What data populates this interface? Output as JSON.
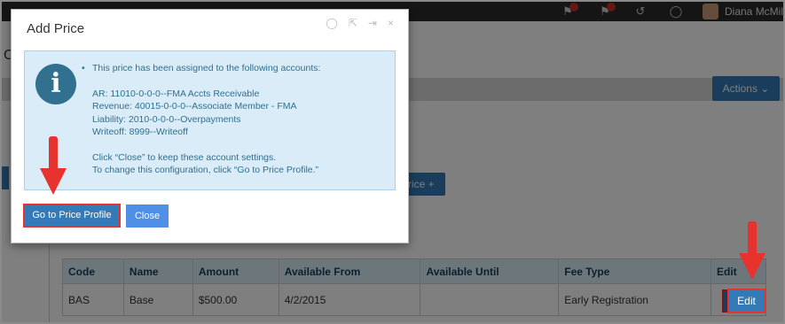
{
  "topbar": {
    "user_name": "Diana McMilli",
    "icons": [
      "flag-icon",
      "alert-icon",
      "history-icon",
      "chat-icon"
    ]
  },
  "background": {
    "actions_label": "Actions ⌄",
    "price_button_label": "rice +",
    "c_letter": "C"
  },
  "table": {
    "headers": [
      "Code",
      "Name",
      "Amount",
      "Available From",
      "Available Until",
      "Fee Type",
      "Edit"
    ],
    "rows": [
      {
        "code": "BAS",
        "name": "Base",
        "amount": "$500.00",
        "available_from": "4/2/2015",
        "available_until": "",
        "fee_type": "Early Registration",
        "edit_label": "Edit"
      }
    ]
  },
  "modal": {
    "title": "Add Price",
    "info_heading": "This price has been assigned to the following accounts:",
    "accounts": [
      "AR: 11010-0-0-0--FMA Accts Receivable",
      "Revenue: 40015-0-0-0--Associate Member - FMA",
      "Liability: 2010-0-0-0--Overpayments",
      "Writeoff: 8999--Writeoff"
    ],
    "note_line_1": "Click “Close” to keep these account settings.",
    "note_line_2": "To change this configuration, click “Go to Price Profile.”",
    "primary_button": "Go to Price Profile",
    "close_button": "Close",
    "icon_glyph": "i"
  },
  "colors": {
    "accent": "#337ab7",
    "highlight": "#e8322e",
    "info_bg": "#d9ecf7",
    "info_text": "#31708f"
  }
}
